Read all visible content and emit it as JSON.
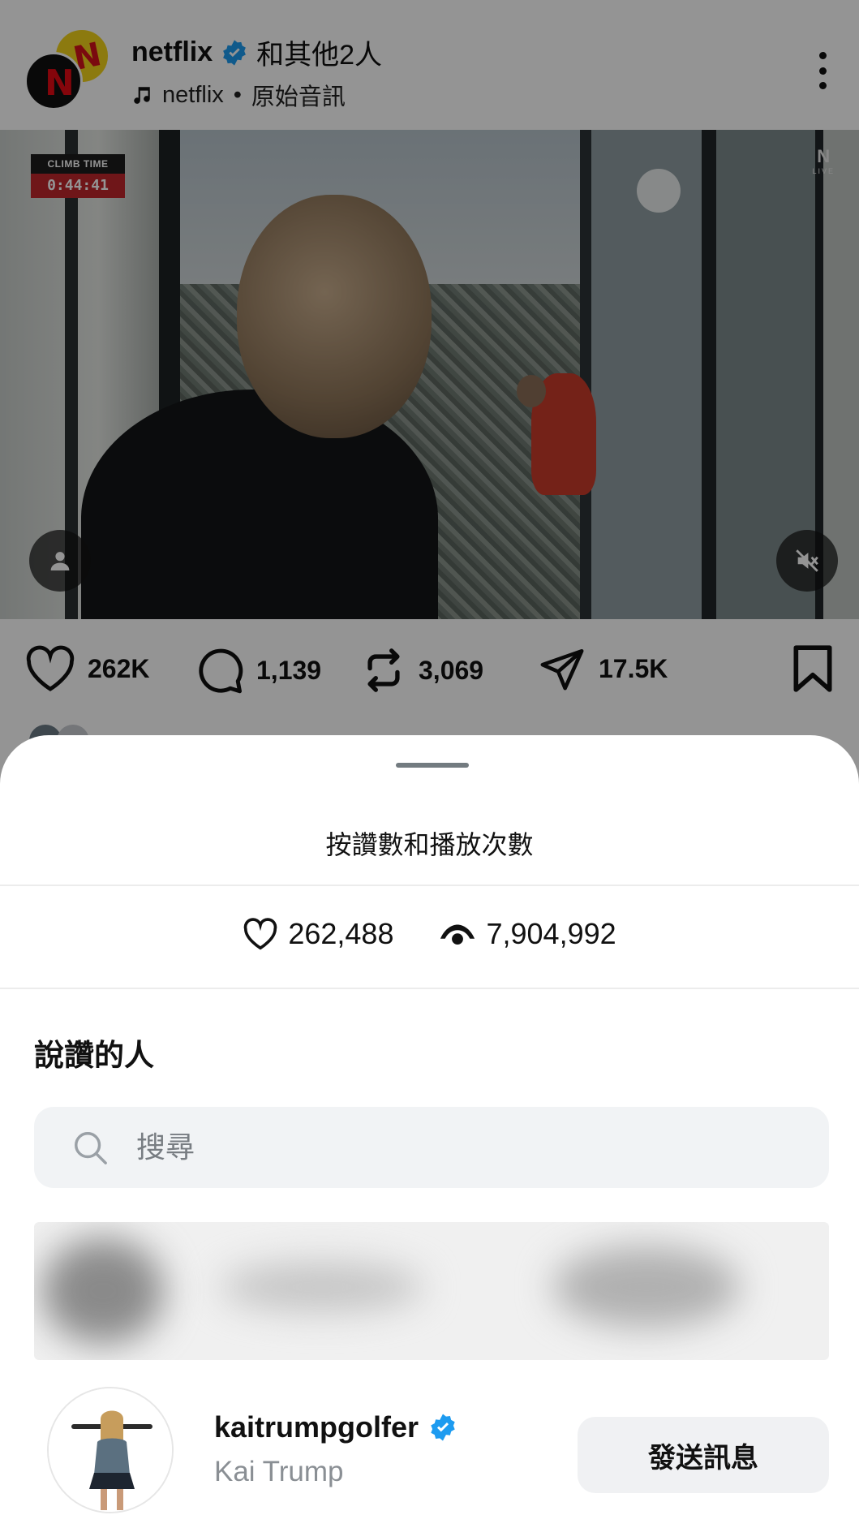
{
  "post": {
    "username": "netflix",
    "coauthors": "和其他2人",
    "audio_artist": "netflix",
    "audio_separator": "•",
    "audio_label": "原始音訊",
    "video": {
      "climb_label": "CLIMB TIME",
      "climb_time": "0:44:41",
      "brand_mark": "N",
      "brand_sub": "LIVE"
    },
    "actions": {
      "likes": "262K",
      "comments": "1,139",
      "reposts": "3,069",
      "shares": "17.5K"
    }
  },
  "sheet": {
    "title": "按讚數和播放次數",
    "like_count": "262,488",
    "view_count": "7,904,992",
    "section_title": "說讚的人",
    "search_placeholder": "搜尋",
    "users": [
      {
        "username": "kaitrumpgolfer",
        "full_name": "Kai Trump",
        "verified": true,
        "button_label": "發送訊息"
      }
    ]
  },
  "colors": {
    "verified_blue": "#1d9bf0",
    "climb_red": "#c0262c",
    "netflix_red": "#e50914",
    "overlay": "rgba(0,0,0,0.42)"
  },
  "icons": {
    "like": "heart-icon",
    "comment": "comment-bubble-icon",
    "repost": "repost-icon",
    "share": "send-icon",
    "save": "bookmark-icon",
    "views": "eye-icon",
    "search": "search-icon",
    "audio": "music-note-icon"
  }
}
